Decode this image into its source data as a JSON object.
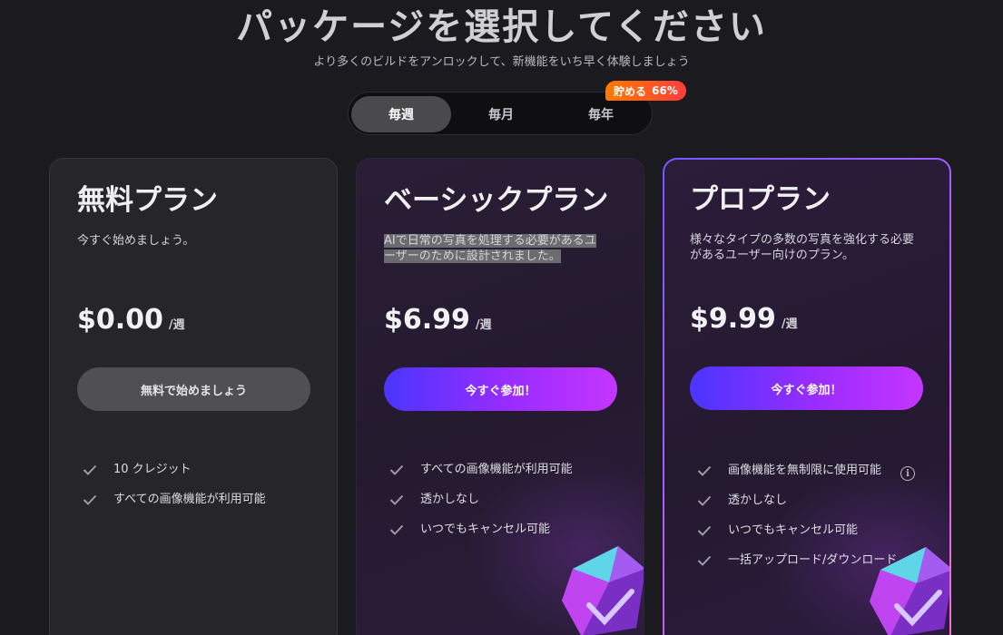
{
  "header": {
    "title": "パッケージを選択してください",
    "subtitle": "より多くのビルドをアンロックして、新機能をいち早く体験しましょう"
  },
  "billing": {
    "options": [
      "毎週",
      "毎月",
      "毎年"
    ],
    "selected": "毎週",
    "badge_label": "貯める",
    "badge_percent": "66%"
  },
  "plans": [
    {
      "name": "無料プラン",
      "description": "今すぐ始めましょう。",
      "price": "$0.00",
      "unit": "/週",
      "cta": "無料で始めましょう",
      "features": [
        "10 クレジット",
        "すべての画像機能が利用可能"
      ]
    },
    {
      "name": "ベーシックプラン",
      "description_line1": "AIで日常の写真を処理する必要があるユ",
      "description_line2": "ーザーのために設計されました。",
      "price": "$6.99",
      "unit": "/週",
      "cta": "今すぐ参加！",
      "features": [
        "すべての画像機能が利用可能",
        "透かしなし",
        "いつでもキャンセル可能"
      ]
    },
    {
      "name": "プロプラン",
      "description": "様々なタイプの多数の写真を強化する必要があるユーザー向けのプラン。",
      "price": "$9.99",
      "unit": "/週",
      "cta": "今すぐ参加！",
      "features": [
        "画像機能を無制限に使用可能",
        "透かしなし",
        "いつでもキャンセル可能",
        "一括アップロード/ダウンロード"
      ]
    }
  ],
  "colors": {
    "background": "#1b1a1f",
    "accent_start": "#4b35ff",
    "accent_end": "#c535ff",
    "badge_start": "#ff7a00",
    "badge_end": "#ff3d3d"
  }
}
